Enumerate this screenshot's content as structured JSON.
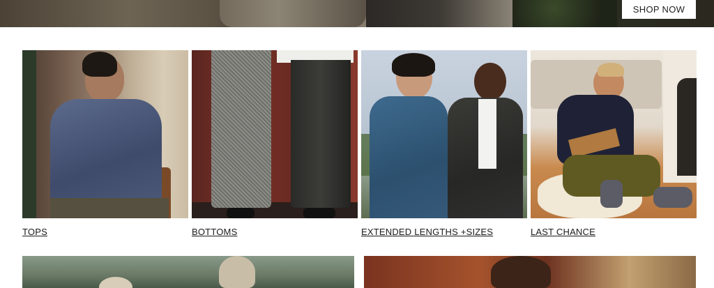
{
  "hero": {
    "cta_label": "SHOP NOW"
  },
  "categories": [
    {
      "label": "TOPS"
    },
    {
      "label": "BOTTOMS"
    },
    {
      "label": "EXTENDED LENGTHS +SIZES"
    },
    {
      "label": "LAST CHANCE"
    }
  ]
}
